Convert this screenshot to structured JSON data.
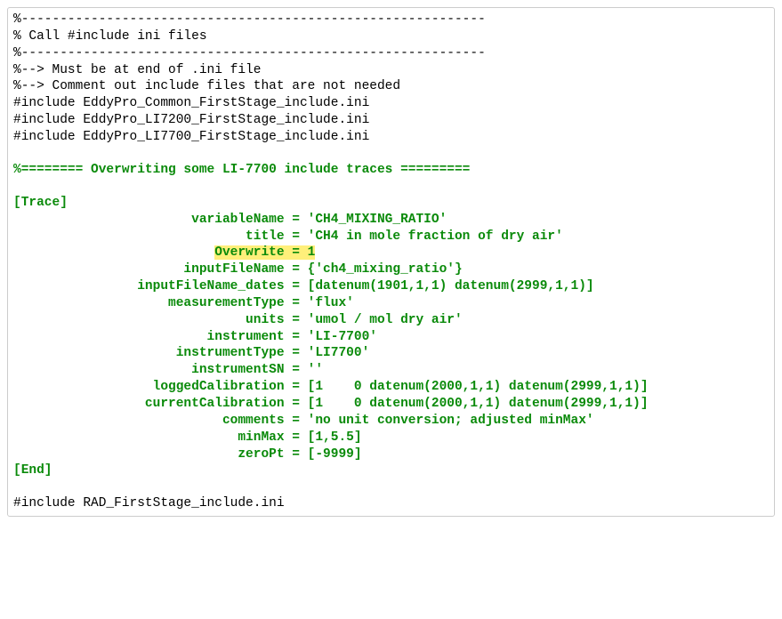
{
  "block1": [
    "%------------------------------------------------------------",
    "% Call #include ini files",
    "%------------------------------------------------------------",
    "%--> Must be at end of .ini file",
    "%--> Comment out include files that are not needed",
    "#include EddyPro_Common_FirstStage_include.ini",
    "#include EddyPro_LI7200_FirstStage_include.ini",
    "#include EddyPro_LI7700_FirstStage_include.ini"
  ],
  "sectionHeader": "%======== Overwriting some LI-7700 include traces =========",
  "traceOpen": "[Trace]",
  "props": [
    {
      "key": "variableName",
      "value": "'CH4_MIXING_RATIO'"
    },
    {
      "key": "title",
      "value": "'CH4 in mole fraction of dry air'"
    },
    {
      "key": "Overwrite",
      "value": "1",
      "highlight": true
    },
    {
      "key": "inputFileName",
      "value": "{'ch4_mixing_ratio'}"
    },
    {
      "key": "inputFileName_dates",
      "value": "[datenum(1901,1,1) datenum(2999,1,1)]"
    },
    {
      "key": "measurementType",
      "value": "'flux'"
    },
    {
      "key": "units",
      "value": "'umol / mol dry air'"
    },
    {
      "key": "instrument",
      "value": "'LI-7700'"
    },
    {
      "key": "instrumentType",
      "value": "'LI7700'"
    },
    {
      "key": "instrumentSN",
      "value": "''"
    },
    {
      "key": "loggedCalibration",
      "value": "[1    0 datenum(2000,1,1) datenum(2999,1,1)]"
    },
    {
      "key": "currentCalibration",
      "value": "[1    0 datenum(2000,1,1) datenum(2999,1,1)]"
    },
    {
      "key": "comments",
      "value": "'no unit conversion; adjusted minMax'"
    },
    {
      "key": "minMax",
      "value": "[1,5.5]"
    },
    {
      "key": "zeroPt",
      "value": "[-9999]"
    }
  ],
  "traceClose": "[End]",
  "block3": [
    "#include RAD_FirstStage_include.ini"
  ],
  "alignColumn": 35
}
